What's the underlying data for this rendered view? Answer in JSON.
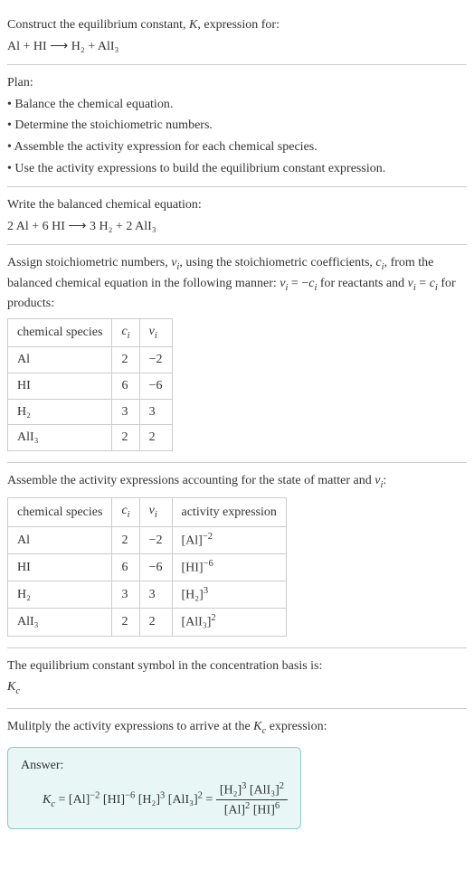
{
  "intro": {
    "line1": "Construct the equilibrium constant, ",
    "k": "K",
    "line1b": ", expression for:",
    "eq": "Al + HI ⟶ H₂ + AlI₃"
  },
  "plan": {
    "title": "Plan:",
    "b1": "• Balance the chemical equation.",
    "b2": "• Determine the stoichiometric numbers.",
    "b3": "• Assemble the activity expression for each chemical species.",
    "b4": "• Use the activity expressions to build the equilibrium constant expression."
  },
  "balanced": {
    "title": "Write the balanced chemical equation:",
    "eq": "2 Al + 6 HI ⟶ 3 H₂ + 2 AlI₃"
  },
  "assign": {
    "p1": "Assign stoichiometric numbers, ",
    "nu": "ν",
    "sub_i": "i",
    "p2": ", using the stoichiometric coefficients, ",
    "c": "c",
    "p3": ", from the balanced chemical equation in the following manner: ",
    "rel1a": "ν",
    "rel1b": " = −",
    "rel1c": "c",
    "p4": " for reactants and ",
    "rel2a": "ν",
    "rel2b": " = ",
    "rel2c": "c",
    "p5": " for products:",
    "headers": {
      "h1": "chemical species",
      "h2": "c",
      "h2sub": "i",
      "h3": "ν",
      "h3sub": "i"
    },
    "rows": [
      {
        "sp": "Al",
        "c": "2",
        "nu": "−2"
      },
      {
        "sp": "HI",
        "c": "6",
        "nu": "−6"
      },
      {
        "sp": "H₂",
        "c": "3",
        "nu": "3"
      },
      {
        "sp": "AlI₃",
        "c": "2",
        "nu": "2"
      }
    ]
  },
  "activity": {
    "title1": "Assemble the activity expressions accounting for the state of matter and ",
    "nu": "ν",
    "sub_i": "i",
    "title2": ":",
    "headers": {
      "h1": "chemical species",
      "h2": "c",
      "h2sub": "i",
      "h3": "ν",
      "h3sub": "i",
      "h4": "activity expression"
    },
    "rows": [
      {
        "sp": "Al",
        "c": "2",
        "nu": "−2",
        "ae_base": "[Al]",
        "ae_exp": "−2"
      },
      {
        "sp": "HI",
        "c": "6",
        "nu": "−6",
        "ae_base": "[HI]",
        "ae_exp": "−6"
      },
      {
        "sp": "H₂",
        "c": "3",
        "nu": "3",
        "ae_base": "[H₂]",
        "ae_exp": "3"
      },
      {
        "sp": "AlI₃",
        "c": "2",
        "nu": "2",
        "ae_base": "[AlI₃]",
        "ae_exp": "2"
      }
    ]
  },
  "symbol": {
    "line": "The equilibrium constant symbol in the concentration basis is:",
    "k": "K",
    "ksub": "c"
  },
  "mult": {
    "line1": "Mulitply the activity expressions to arrive at the ",
    "k": "K",
    "ksub": "c",
    "line2": " expression:"
  },
  "answer": {
    "label": "Answer:",
    "k": "K",
    "ksub": "c",
    "eq": " = ",
    "t1": "[Al]",
    "e1": "−2",
    "t2": " [HI]",
    "e2": "−6",
    "t3": " [H₂]",
    "e3": "3",
    "t4": " [AlI₃]",
    "e4": "2",
    "eq2": " = ",
    "num1": "[H₂]",
    "ne1": "3",
    "num2": " [AlI₃]",
    "ne2": "2",
    "den1": "[Al]",
    "de1": "2",
    "den2": " [HI]",
    "de2": "6"
  }
}
